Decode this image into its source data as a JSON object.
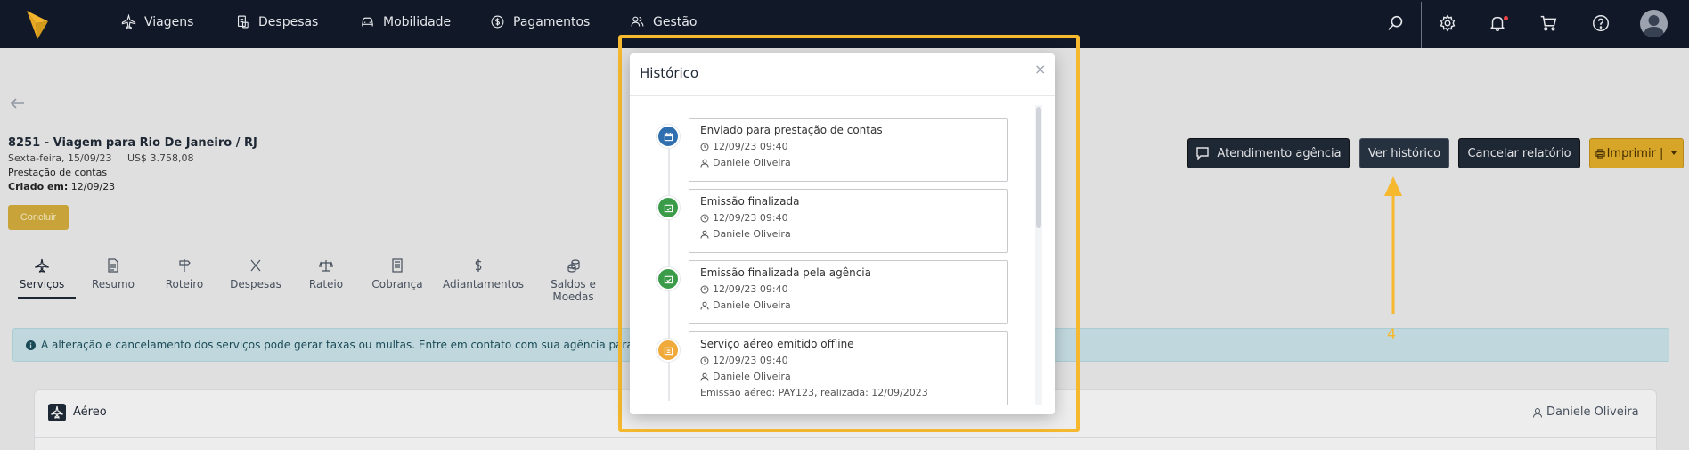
{
  "nav": {
    "items": [
      {
        "label": "Viagens",
        "icon": "plane-icon"
      },
      {
        "label": "Despesas",
        "icon": "receipt-icon"
      },
      {
        "label": "Mobilidade",
        "icon": "car-icon"
      },
      {
        "label": "Pagamentos",
        "icon": "dollar-circle-icon"
      },
      {
        "label": "Gestão",
        "icon": "users-icon"
      }
    ],
    "right_icons": [
      "search-icon",
      "gear-icon",
      "bell-icon",
      "cart-icon",
      "help-icon",
      "avatar"
    ]
  },
  "report": {
    "title": "8251 - Viagem para Rio De Janeiro / RJ",
    "date": "Sexta-feira, 15/09/23",
    "amount": "US$ 3.758,08",
    "status": "Prestação de contas",
    "created_label": "Criado em:",
    "created_value": "12/09/23",
    "conclude_label": "Concluir"
  },
  "actions": {
    "atendimento": "Atendimento agência",
    "historico": "Ver histórico",
    "cancelar": "Cancelar relatório",
    "imprimir": "Imprimir |"
  },
  "tabs": [
    "Serviços",
    "Resumo",
    "Roteiro",
    "Despesas",
    "Rateio",
    "Cobrança",
    "Adiantamentos",
    "Saldos e Moedas"
  ],
  "alert": {
    "text": "A alteração e cancelamento dos serviços pode gerar taxas ou multas. Entre em contato com sua agência para mais in"
  },
  "card": {
    "title": "Aéreo",
    "user": "Daniele Oliveira"
  },
  "modal": {
    "title": "Histórico",
    "close": "×",
    "events": [
      {
        "title": "Enviado para prestação de contas",
        "time": "12/09/23 09:40",
        "user": "Daniele Oliveira",
        "color": "#2f6fb0",
        "extra": ""
      },
      {
        "title": "Emissão finalizada",
        "time": "12/09/23 09:40",
        "user": "Daniele Oliveira",
        "color": "#3a9b48",
        "extra": ""
      },
      {
        "title": "Emissão finalizada pela agência",
        "time": "12/09/23 09:40",
        "user": "Daniele Oliveira",
        "color": "#3a9b48",
        "extra": ""
      },
      {
        "title": "Serviço aéreo emitido offline",
        "time": "12/09/23 09:40",
        "user": "Daniele Oliveira",
        "color": "#f0a93b",
        "extra": "Emissão aéreo: PAY123, realizada: 12/09/2023"
      }
    ]
  },
  "annotation": {
    "number": "4",
    "color": "#f5b82e"
  }
}
